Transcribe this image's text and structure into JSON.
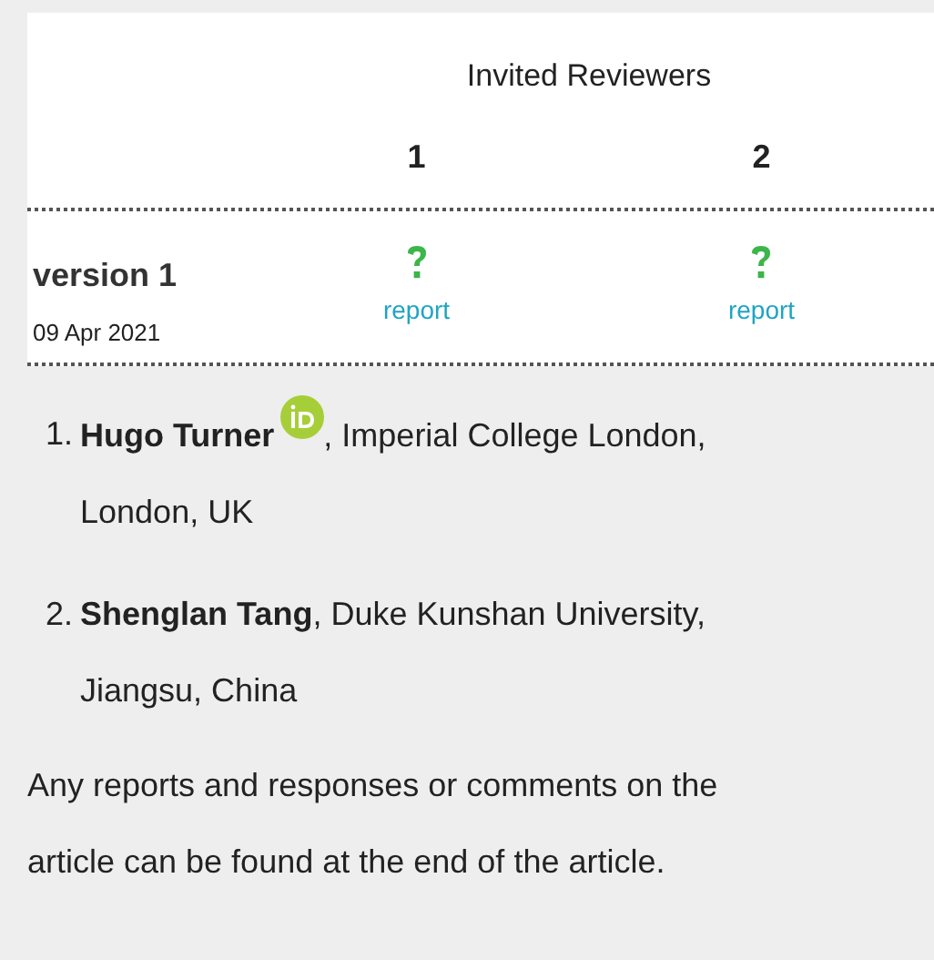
{
  "table": {
    "group_heading": "Invited Reviewers",
    "columns": [
      "1",
      "2"
    ],
    "rows": [
      {
        "label": "version 1",
        "date": "09 Apr 2021",
        "cells": [
          {
            "kind": "pending",
            "link": "report"
          },
          {
            "kind": "pending",
            "link": "report"
          }
        ]
      }
    ]
  },
  "reviewers": [
    {
      "number": "1.",
      "name": "Hugo Turner",
      "orcid": true,
      "affiliation": ", Imperial College London, London, UK"
    },
    {
      "number": "2.",
      "name": "Shenglan Tang",
      "orcid": false,
      "affiliation": ", Duke Kunshan University, Jiangsu, China"
    }
  ],
  "note": "Any reports and responses or comments on the article can be found at the end of the article."
}
